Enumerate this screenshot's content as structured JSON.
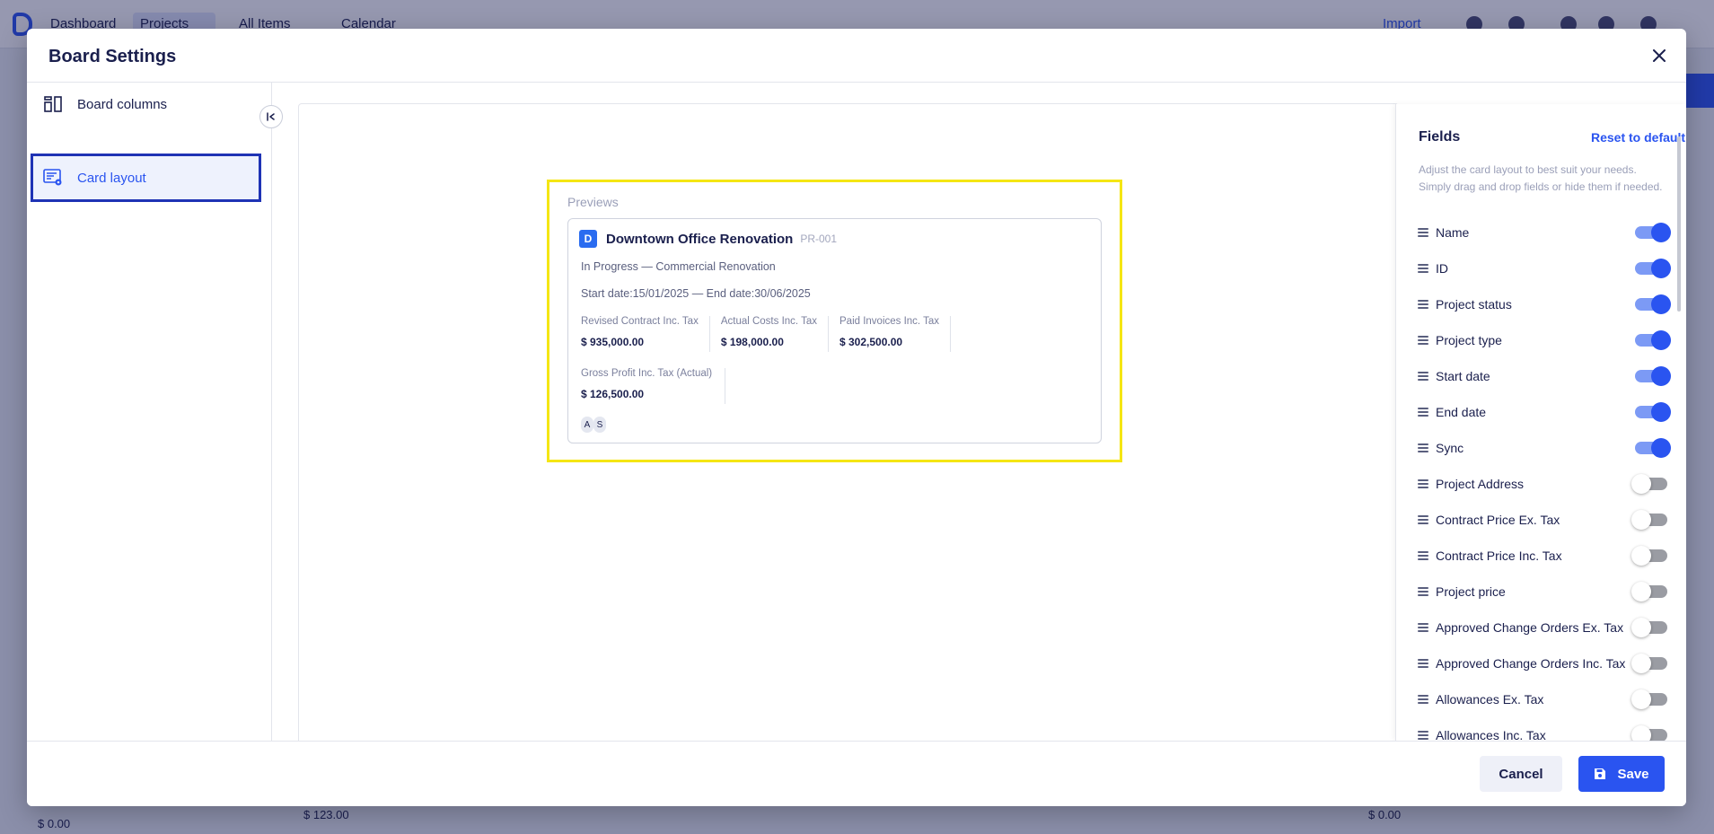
{
  "background": {
    "nav": [
      "Dashboard",
      "Projects",
      "All Items",
      "Calendar"
    ],
    "import_label": "Import",
    "bottom_values": [
      "$ 0.00",
      "$ 123.00",
      "$ 0.00"
    ]
  },
  "modal": {
    "title": "Board Settings",
    "close_icon": "close-icon"
  },
  "sidebar": {
    "items": [
      {
        "label": "Board columns",
        "icon": "board-columns-icon",
        "active": false
      },
      {
        "label": "Card layout",
        "icon": "card-layout-icon",
        "active": true
      }
    ]
  },
  "preview": {
    "title": "Previews",
    "card": {
      "badge": "D",
      "name": "Downtown Office Renovation",
      "id": "PR-001",
      "status_line": "In Progress — Commercial Renovation",
      "dates_line": "Start date:15/01/2025 — End date:30/06/2025",
      "metrics": [
        {
          "label": "Revised Contract Inc. Tax",
          "value": "$ 935,000.00"
        },
        {
          "label": "Actual Costs Inc. Tax",
          "value": "$ 198,000.00"
        },
        {
          "label": "Paid Invoices Inc. Tax",
          "value": "$ 302,500.00"
        }
      ],
      "metrics2": [
        {
          "label": "Gross Profit Inc. Tax (Actual)",
          "value": "$ 126,500.00"
        }
      ],
      "avatars": [
        "A",
        "S"
      ]
    }
  },
  "fields": {
    "title": "Fields",
    "reset_label": "Reset to default",
    "description": "Adjust the card layout to best suit your needs. Simply drag and drop fields or hide them if needed.",
    "items": [
      {
        "label": "Name",
        "enabled": true
      },
      {
        "label": "ID",
        "enabled": true
      },
      {
        "label": "Project status",
        "enabled": true
      },
      {
        "label": "Project type",
        "enabled": true
      },
      {
        "label": "Start date",
        "enabled": true
      },
      {
        "label": "End date",
        "enabled": true
      },
      {
        "label": "Sync",
        "enabled": true
      },
      {
        "label": "Project Address",
        "enabled": false
      },
      {
        "label": "Contract Price Ex. Tax",
        "enabled": false
      },
      {
        "label": "Contract Price Inc. Tax",
        "enabled": false
      },
      {
        "label": "Project price",
        "enabled": false
      },
      {
        "label": "Approved Change Orders Ex. Tax",
        "enabled": false
      },
      {
        "label": "Approved Change Orders Inc. Tax",
        "enabled": false
      },
      {
        "label": "Allowances Ex. Tax",
        "enabled": false
      },
      {
        "label": "Allowances Inc. Tax",
        "enabled": false
      }
    ]
  },
  "footer": {
    "cancel_label": "Cancel",
    "save_label": "Save"
  },
  "colors": {
    "accent": "#2a54f0",
    "highlight_preview": "#f5e614",
    "highlight_sidebar": "#1f33b5"
  }
}
